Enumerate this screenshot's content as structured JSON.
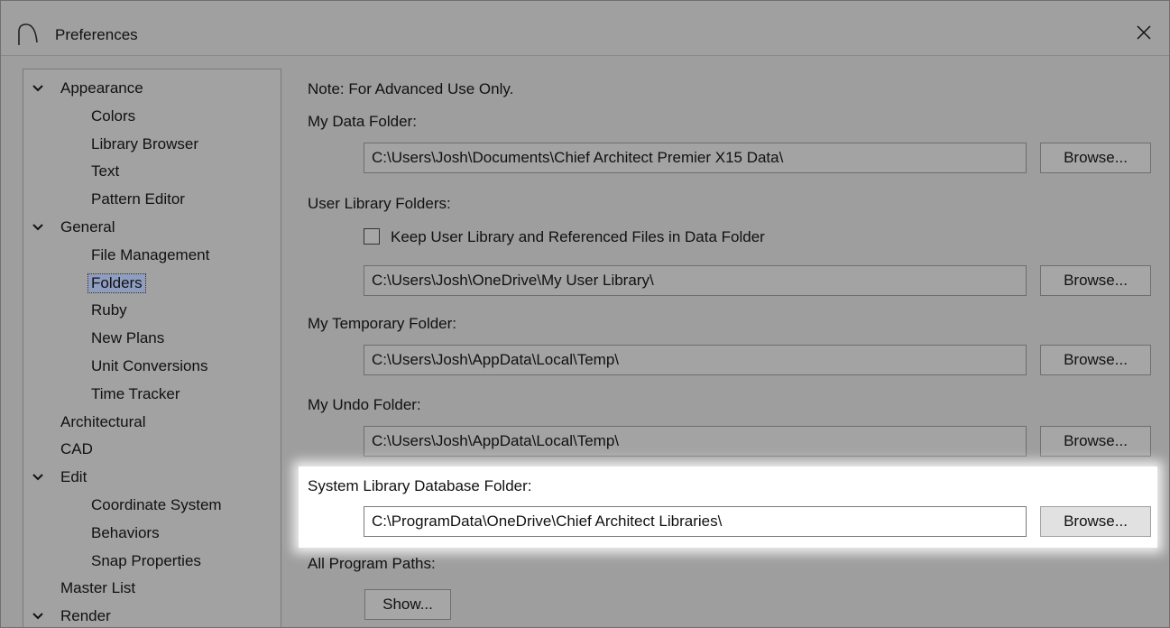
{
  "window": {
    "title": "Preferences",
    "close_glyph": "✕"
  },
  "tree": {
    "items": [
      {
        "label": "Appearance",
        "level": 0,
        "expanded": true
      },
      {
        "label": "Colors",
        "level": 1
      },
      {
        "label": "Library Browser",
        "level": 1
      },
      {
        "label": "Text",
        "level": 1
      },
      {
        "label": "Pattern Editor",
        "level": 1
      },
      {
        "label": "General",
        "level": 0,
        "expanded": true
      },
      {
        "label": "File Management",
        "level": 1
      },
      {
        "label": "Folders",
        "level": 1,
        "selected": true
      },
      {
        "label": "Ruby",
        "level": 1
      },
      {
        "label": "New Plans",
        "level": 1
      },
      {
        "label": "Unit Conversions",
        "level": 1
      },
      {
        "label": "Time Tracker",
        "level": 1
      },
      {
        "label": "Architectural",
        "level": 0
      },
      {
        "label": "CAD",
        "level": 0
      },
      {
        "label": "Edit",
        "level": 0,
        "expanded": true
      },
      {
        "label": "Coordinate System",
        "level": 1
      },
      {
        "label": "Behaviors",
        "level": 1
      },
      {
        "label": "Snap Properties",
        "level": 1
      },
      {
        "label": "Master List",
        "level": 0
      },
      {
        "label": "Render",
        "level": 0,
        "expanded": true
      }
    ]
  },
  "content": {
    "note": "Note: For Advanced Use Only.",
    "my_data_folder": {
      "label": "My Data Folder:",
      "path": "C:\\Users\\Josh\\Documents\\Chief Architect Premier X15 Data\\",
      "browse": "Browse..."
    },
    "user_library": {
      "label": "User Library Folders:",
      "checkbox_label": "Keep User Library and Referenced Files in Data Folder",
      "checked": false,
      "path": "C:\\Users\\Josh\\OneDrive\\My User Library\\",
      "browse": "Browse..."
    },
    "temp_folder": {
      "label": "My Temporary Folder:",
      "path": "C:\\Users\\Josh\\AppData\\Local\\Temp\\",
      "browse": "Browse..."
    },
    "undo_folder": {
      "label": "My Undo Folder:",
      "path": "C:\\Users\\Josh\\AppData\\Local\\Temp\\",
      "browse": "Browse..."
    },
    "system_library": {
      "label": "System Library Database Folder:",
      "path": "C:\\ProgramData\\OneDrive\\Chief Architect Libraries\\",
      "browse": "Browse..."
    },
    "program_paths": {
      "label": "All Program Paths:",
      "show": "Show..."
    }
  }
}
